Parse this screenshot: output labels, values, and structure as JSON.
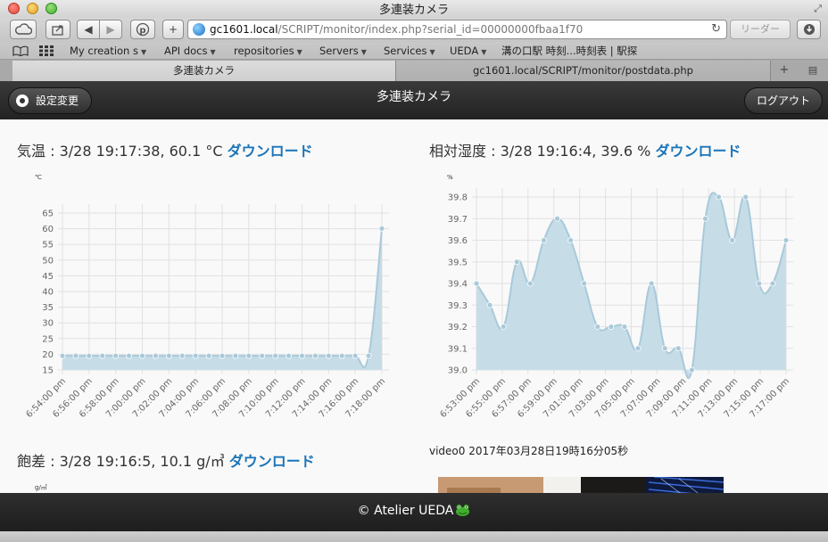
{
  "window": {
    "title": "多連装カメラ"
  },
  "toolbar": {
    "url_host": "gc1601.local",
    "url_path": "/SCRIPT/monitor/index.php?serial_id=00000000fbaa1f70",
    "reader_label": "リーダー"
  },
  "bookmarks": [
    {
      "label": "My creation s",
      "has_menu": true
    },
    {
      "label": "API docs",
      "has_menu": true
    },
    {
      "label": "repositories",
      "has_menu": true
    },
    {
      "label": "Servers",
      "has_menu": true
    },
    {
      "label": "Services",
      "has_menu": true
    },
    {
      "label": "UEDA",
      "has_menu": true
    },
    {
      "label": "溝の口駅 時刻...時刻表 | 駅探",
      "has_menu": false
    }
  ],
  "tabs": [
    {
      "label": "多連装カメラ",
      "active": true
    },
    {
      "label": "gc1601.local/SCRIPT/monitor/postdata.php",
      "active": false
    }
  ],
  "header": {
    "settings_label": "設定変更",
    "title": "多連装カメラ",
    "logout_label": "ログアウト"
  },
  "panels": {
    "temperature": {
      "title": "気温 : 3/28 19:17:38, 60.1 °C",
      "download_label": "ダウンロード",
      "unit": "℃"
    },
    "humidity": {
      "title": "相対湿度 : 3/28 19:16:4, 39.6 %",
      "download_label": "ダウンロード",
      "unit": "%"
    },
    "dewpoint": {
      "title": "飽差 : 3/28 19:16:5, 10.1 g/㎥",
      "download_label": "ダウンロード",
      "unit": "g/㎥"
    },
    "video": {
      "label": "video0 2017年03月28日19時16分05秒"
    }
  },
  "footer": {
    "text": "© Atelier UEDA"
  },
  "colors": {
    "fill": "#c6dde8",
    "line": "#a9c9d9",
    "grid": "#e1e1e1",
    "link": "#1a74b8",
    "header_bg": "#2b2b2b"
  },
  "chart_data": [
    {
      "type": "area",
      "title": "",
      "xlabel": "",
      "ylabel": "℃",
      "ylim": [
        15,
        65
      ],
      "yticks": [
        15,
        20,
        25,
        30,
        35,
        40,
        45,
        50,
        55,
        60,
        65
      ],
      "x_tick_labels": [
        "6:54:00 pm",
        "6:56:00 pm",
        "6:58:00 pm",
        "7:00:00 pm",
        "7:02:00 pm",
        "7:04:00 pm",
        "7:06:00 pm",
        "7:08:00 pm",
        "7:10:00 pm",
        "7:12:00 pm",
        "7:14:00 pm",
        "7:16:00 pm",
        "7:18:00 pm"
      ],
      "values": [
        19.5,
        19.5,
        19.5,
        19.5,
        19.5,
        19.5,
        19.5,
        19.5,
        19.5,
        19.5,
        19.5,
        19.5,
        19.5,
        19.5,
        19.5,
        19.5,
        19.5,
        19.5,
        19.5,
        19.5,
        19.5,
        19.5,
        19.5,
        19.5,
        60.1
      ],
      "grid": true,
      "legend": "none"
    },
    {
      "type": "area",
      "title": "",
      "xlabel": "",
      "ylabel": "%",
      "ylim": [
        39.0,
        39.8
      ],
      "yticks": [
        39.0,
        39.1,
        39.2,
        39.3,
        39.4,
        39.5,
        39.6,
        39.7,
        39.8
      ],
      "x_tick_labels": [
        "6:53:00 pm",
        "6:55:00 pm",
        "6:57:00 pm",
        "6:59:00 pm",
        "7:01:00 pm",
        "7:03:00 pm",
        "7:05:00 pm",
        "7:07:00 pm",
        "7:09:00 pm",
        "7:11:00 pm",
        "7:13:00 pm",
        "7:15:00 pm",
        "7:17:00 pm"
      ],
      "values": [
        39.4,
        39.3,
        39.2,
        39.5,
        39.4,
        39.6,
        39.7,
        39.6,
        39.4,
        39.2,
        39.2,
        39.2,
        39.1,
        39.4,
        39.1,
        39.1,
        39.0,
        39.7,
        39.8,
        39.6,
        39.8,
        39.4,
        39.4,
        39.6
      ],
      "grid": true,
      "legend": "none"
    }
  ]
}
